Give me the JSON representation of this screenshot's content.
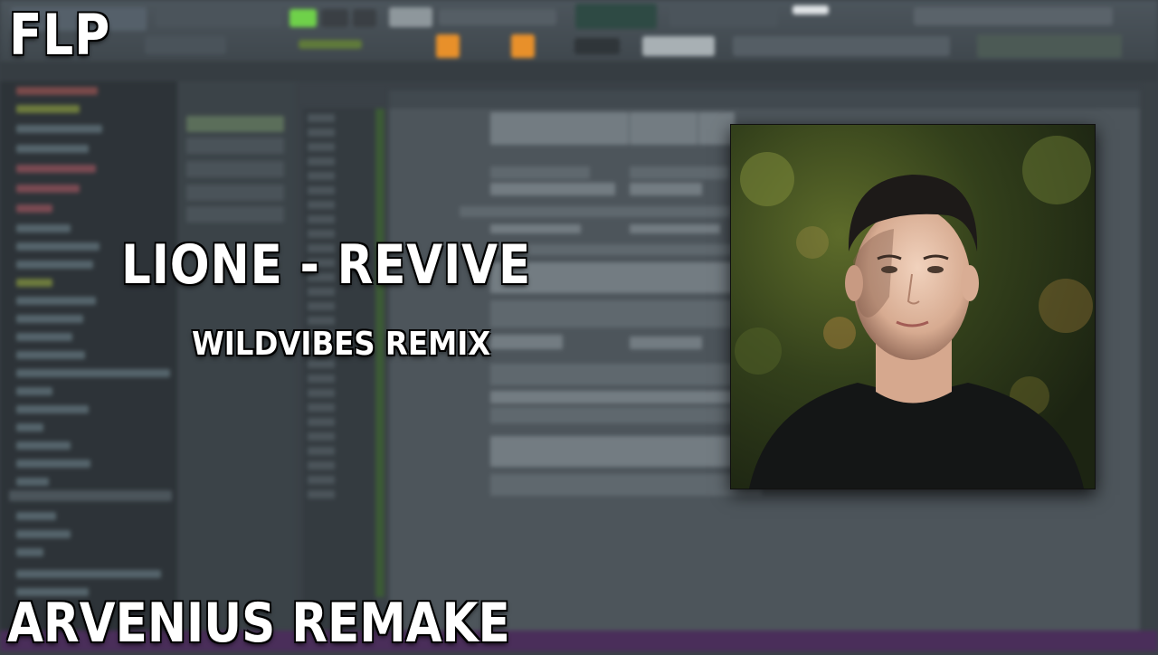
{
  "overlay": {
    "top_left_label": "FLP",
    "song_title": "LIONE - REVIVE",
    "remix_label": "WILDVIBES REMIX",
    "bottom_label": "ARVENIUS REMAKE"
  },
  "colors": {
    "text": "#ffffff",
    "daw_background": "#3a4147",
    "bottom_bar": "#4a2e5a",
    "accent_orange": "#e8902a",
    "accent_green": "#6fd14a"
  },
  "icons": [
    "portrait-photo"
  ]
}
